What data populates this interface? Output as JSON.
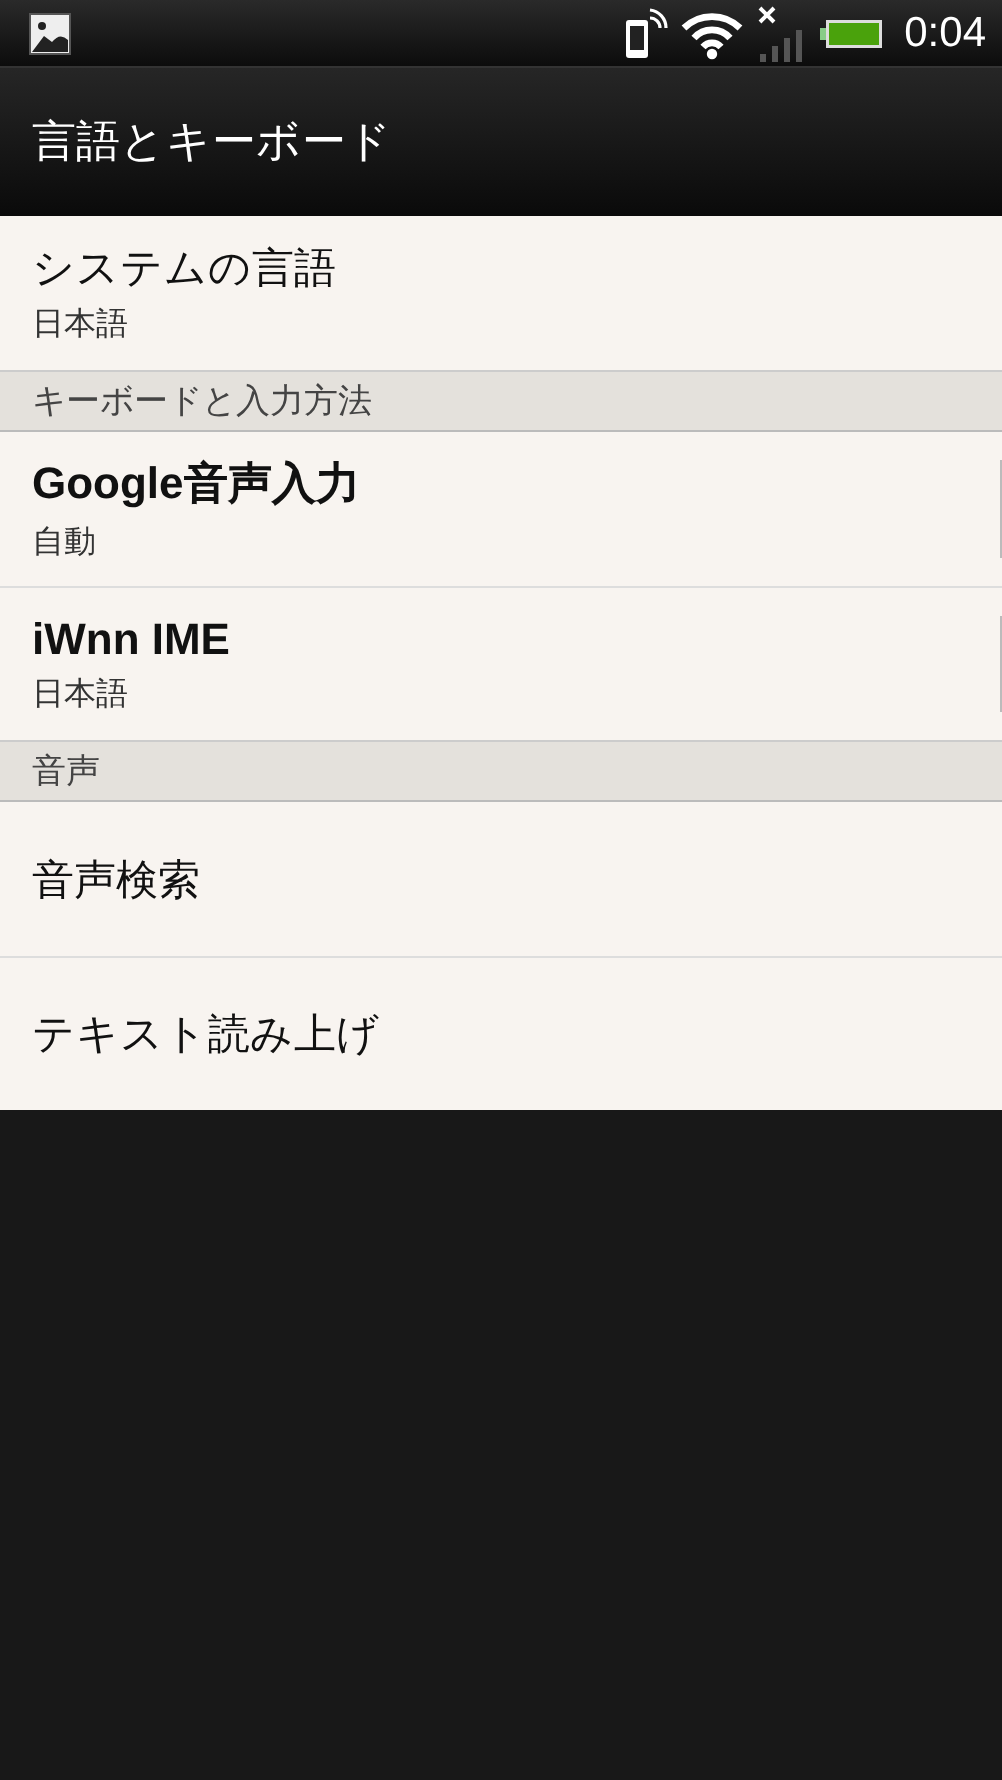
{
  "status_bar": {
    "time": "0:04"
  },
  "title": "言語とキーボード",
  "sections": [
    {
      "items": [
        {
          "kind": "setting",
          "title": "システムの言語",
          "summary": "日本語"
        }
      ]
    },
    {
      "header": "キーボードと入力方法",
      "items": [
        {
          "kind": "input_method",
          "title": "Google音声入力",
          "summary": "自動"
        },
        {
          "kind": "input_method",
          "title": "iWnn IME",
          "summary": "日本語"
        }
      ]
    },
    {
      "header": "音声",
      "items": [
        {
          "kind": "setting",
          "title": "音声検索"
        },
        {
          "kind": "setting",
          "title": "テキスト読み上げ"
        }
      ]
    }
  ]
}
